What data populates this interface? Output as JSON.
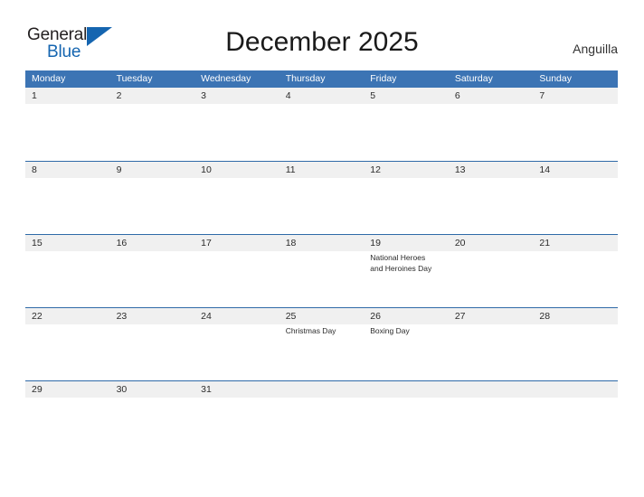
{
  "brand": {
    "name_part1": "General",
    "name_part2": "Blue",
    "triangle_icon": "blue-triangle-icon",
    "primary_color": "#1565b0",
    "text_color": "#231f20"
  },
  "header": {
    "title": "December 2025",
    "country": "Anguilla"
  },
  "calendar": {
    "header_bg_color": "#3c74b4",
    "row_band_color": "#f0f0f0",
    "row_line_color": "#2f6aa8",
    "weekdays": [
      "Monday",
      "Tuesday",
      "Wednesday",
      "Thursday",
      "Friday",
      "Saturday",
      "Sunday"
    ],
    "weeks": [
      {
        "days": [
          {
            "number": "1",
            "events": []
          },
          {
            "number": "2",
            "events": []
          },
          {
            "number": "3",
            "events": []
          },
          {
            "number": "4",
            "events": []
          },
          {
            "number": "5",
            "events": []
          },
          {
            "number": "6",
            "events": []
          },
          {
            "number": "7",
            "events": []
          }
        ]
      },
      {
        "days": [
          {
            "number": "8",
            "events": []
          },
          {
            "number": "9",
            "events": []
          },
          {
            "number": "10",
            "events": []
          },
          {
            "number": "11",
            "events": []
          },
          {
            "number": "12",
            "events": []
          },
          {
            "number": "13",
            "events": []
          },
          {
            "number": "14",
            "events": []
          }
        ]
      },
      {
        "days": [
          {
            "number": "15",
            "events": []
          },
          {
            "number": "16",
            "events": []
          },
          {
            "number": "17",
            "events": []
          },
          {
            "number": "18",
            "events": []
          },
          {
            "number": "19",
            "events": [
              "National Heroes",
              "and Heroines Day"
            ]
          },
          {
            "number": "20",
            "events": []
          },
          {
            "number": "21",
            "events": []
          }
        ]
      },
      {
        "days": [
          {
            "number": "22",
            "events": []
          },
          {
            "number": "23",
            "events": []
          },
          {
            "number": "24",
            "events": []
          },
          {
            "number": "25",
            "events": [
              "Christmas Day"
            ]
          },
          {
            "number": "26",
            "events": [
              "Boxing Day"
            ]
          },
          {
            "number": "27",
            "events": []
          },
          {
            "number": "28",
            "events": []
          }
        ]
      },
      {
        "days": [
          {
            "number": "29",
            "events": []
          },
          {
            "number": "30",
            "events": []
          },
          {
            "number": "31",
            "events": []
          },
          {
            "number": "",
            "events": []
          },
          {
            "number": "",
            "events": []
          },
          {
            "number": "",
            "events": []
          },
          {
            "number": "",
            "events": []
          }
        ]
      }
    ]
  }
}
